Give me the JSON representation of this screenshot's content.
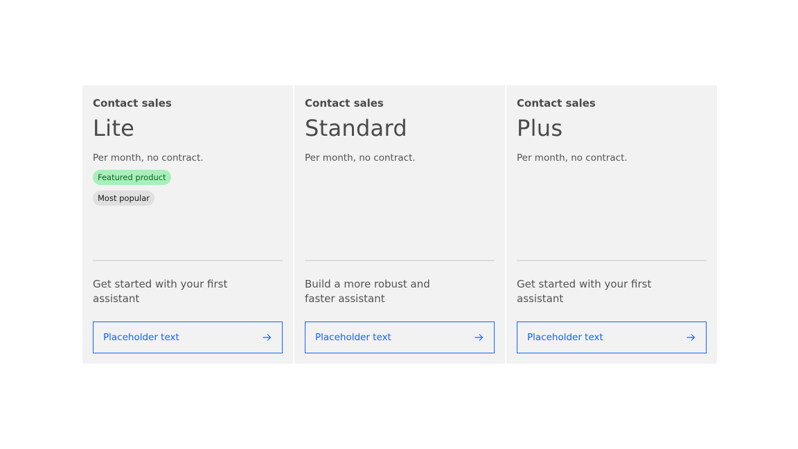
{
  "cards": [
    {
      "eyebrow": "Contact sales",
      "name": "Lite",
      "price_note": "Per month, no contract.",
      "tags": [
        "Featured product",
        "Most popular"
      ],
      "description": "Get started with your first assistant",
      "cta_label": "Placeholder text"
    },
    {
      "eyebrow": "Contact sales",
      "name": "Standard",
      "price_note": "Per month, no contract.",
      "tags": [],
      "description": "Build a more robust and faster assistant",
      "cta_label": "Placeholder text"
    },
    {
      "eyebrow": "Contact sales",
      "name": "Plus",
      "price_note": "Per month, no contract.",
      "tags": [],
      "description": "Get started with your first assistant",
      "cta_label": "Placeholder text"
    }
  ],
  "colors": {
    "card_bg": "#f2f2f2",
    "link_blue": "#0f62fe",
    "tag_green_bg": "#a7f0ba",
    "tag_gray_bg": "#e0e0e0"
  },
  "icons": {
    "cta_icon": "arrow-right-icon"
  }
}
